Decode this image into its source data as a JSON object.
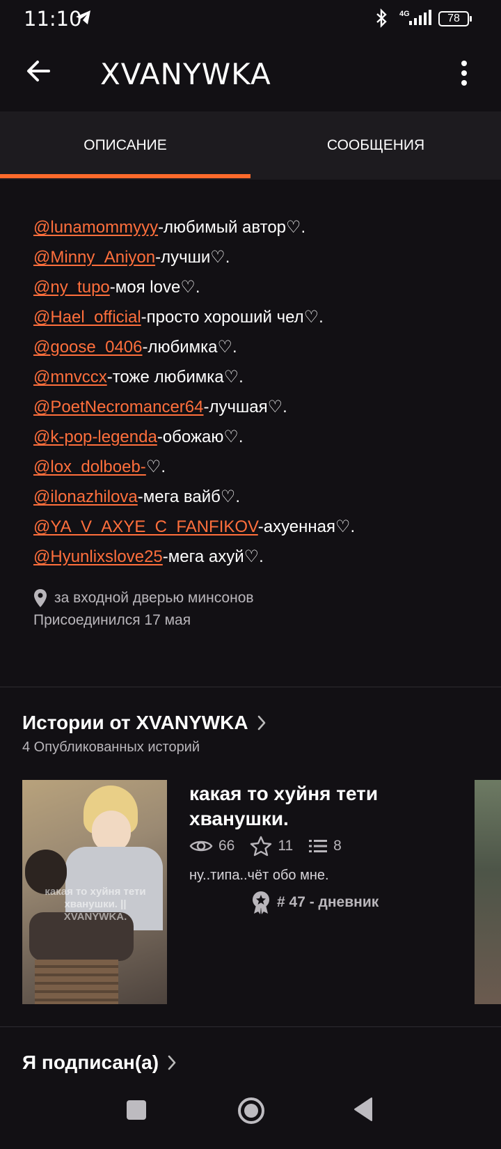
{
  "status_bar": {
    "time": "11:10",
    "network": "4G",
    "battery": "78"
  },
  "app_bar": {
    "title": "XVANYWKA"
  },
  "tabs": [
    {
      "label": "ОПИСАНИЕ",
      "active": true
    },
    {
      "label": "СООБЩЕНИЯ",
      "active": false
    }
  ],
  "description": [
    {
      "mention": "@lunamommyyy",
      "text": "-любимый автор♡."
    },
    {
      "mention": "@Minny_Aniyon",
      "text": "-лучши♡."
    },
    {
      "mention": "@ny_tupo",
      "text": "-моя love♡."
    },
    {
      "mention": "@Hael_official",
      "text": "-просто хороший чел♡."
    },
    {
      "mention": "@goose_0406",
      "text": "-любимка♡."
    },
    {
      "mention": "@mnvccx",
      "text": "-тоже любимка♡."
    },
    {
      "mention": "@PoetNecromancer64",
      "text": "-лучшая♡."
    },
    {
      "mention": "@k-pop-legenda",
      "text": "-обожаю♡."
    },
    {
      "mention": "@lox_dolboeb-",
      "text": "♡."
    },
    {
      "mention": "@ilonazhilova",
      "text": "-мега вайб♡."
    },
    {
      "mention": "@YA_V_AXYE_C_FANFIKOV",
      "text": "-ахуенная♡."
    },
    {
      "mention": "@Hyunlixslove25",
      "text": "-мега ахуй♡."
    }
  ],
  "profile_meta": {
    "location": "за входной дверью минсонов",
    "joined": "Присоединился 17 мая"
  },
  "stories_section": {
    "title": "Истории от XVANYWKA",
    "subtitle": "4 Опубликованных историй"
  },
  "story": {
    "title": "какая то хуйня тети хванушки.",
    "views": "66",
    "votes": "11",
    "parts": "8",
    "description": "ну..типа..чёт обо мне.",
    "rank": "# 47 - дневник",
    "cover_text": "какая то хуйня тети хванушки. || XVANYWKA."
  },
  "following_section": {
    "title": "Я подписан(а)"
  },
  "colors": {
    "accent": "#ff6a2b",
    "background": "#121014",
    "tab_bar": "#1d1b1f",
    "muted_text": "#b9b6bb"
  }
}
